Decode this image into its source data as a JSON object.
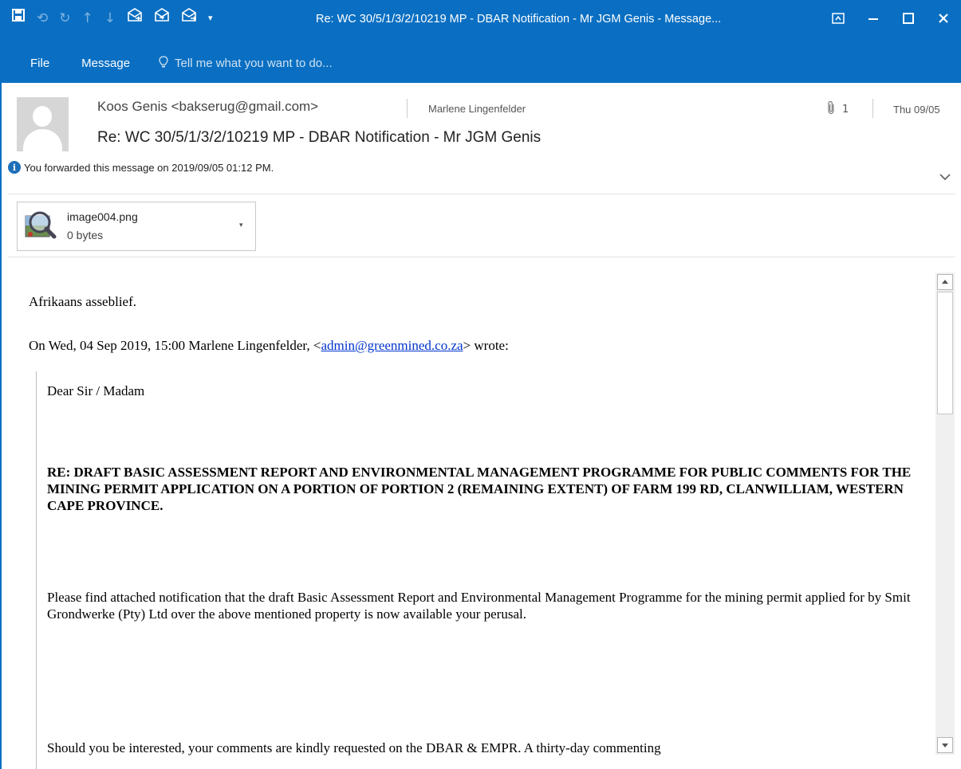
{
  "window": {
    "title": "Re: WC 30/5/1/3/2/10219 MP - DBAR Notification - Mr JGM Genis - Message...",
    "controls": [
      "ribbon-display-options",
      "minimize",
      "maximize",
      "close"
    ]
  },
  "quick_access": [
    "save-icon",
    "undo-icon",
    "redo-icon",
    "previous-item-icon",
    "next-item-icon",
    "reply-icon",
    "reply-all-icon",
    "forward-icon",
    "customize-dropdown-icon"
  ],
  "menu": {
    "file": "File",
    "message": "Message",
    "tell_me": "Tell me what you want to do..."
  },
  "header": {
    "sender": "Koos Genis <bakserug@gmail.com>",
    "recipient": "Marlene Lingenfelder",
    "attachment_count": "1",
    "date": "Thu 09/05",
    "subject": "Re: WC 30/5/1/3/2/10219 MP - DBAR Notification - Mr JGM Genis",
    "info": "You forwarded this message on 2019/09/05 01:12 PM."
  },
  "attachment": {
    "filename": "image004.png",
    "size": "0 bytes"
  },
  "body": {
    "greeting": "Afrikaans asseblief.",
    "wrote_prefix": "On Wed, 04 Sep 2019, 15:00 Marlene Lingenfelder, <",
    "wrote_link": "admin@greenmined.co.za",
    "wrote_suffix": "> wrote:",
    "quote": {
      "salutation": "Dear Sir / Madam",
      "re_heading": "RE: DRAFT BASIC ASSESSMENT REPORT AND ENVIRONMENTAL MANAGEMENT PROGRAMME FOR PUBLIC COMMENTS FOR THE MINING PERMIT APPLICATION ON A PORTION OF PORTION 2 (REMAINING EXTENT) OF FARM 199 RD, CLANWILLIAM, WESTERN CAPE PROVINCE.",
      "paragraph": "Please find attached notification that the draft Basic Assessment Report and Environmental Management Programme for the mining permit applied for by Smit Grondwerke (Pty) Ltd over the above mentioned property is now available your perusal.",
      "paragraph2": "Should you be interested, your comments are kindly requested on the DBAR & EMPR. A thirty-day commenting"
    }
  },
  "colors": {
    "titlebar": "#0a6fc2",
    "link": "#0033cc",
    "info_icon": "#1e6fb8"
  }
}
